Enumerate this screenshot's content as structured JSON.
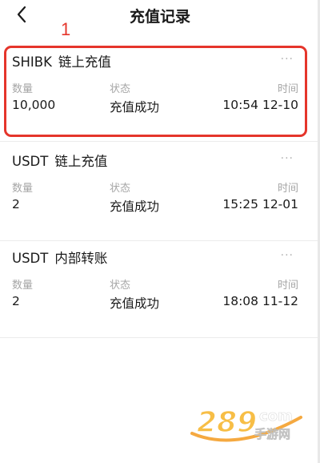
{
  "header": {
    "title": "充值记录"
  },
  "annotation": {
    "number": "1"
  },
  "labels": {
    "quantity": "数量",
    "status": "状态",
    "time": "时间",
    "more": "···"
  },
  "records": [
    {
      "symbol": "SHIBK",
      "type": "链上充值",
      "quantity": "10,000",
      "status": "充值成功",
      "time": "10:54 12-10"
    },
    {
      "symbol": "USDT",
      "type": "链上充值",
      "quantity": "2",
      "status": "充值成功",
      "time": "15:25 12-01"
    },
    {
      "symbol": "USDT",
      "type": "内部转账",
      "quantity": "2",
      "status": "充值成功",
      "time": "18:08 11-12"
    }
  ],
  "watermark": {
    "text": "289",
    "suffix": "com",
    "subtitle": "手游网"
  },
  "colors": {
    "accent_red": "#e5352b",
    "label_gray": "#a6a6a6",
    "text_dark": "#1a1a1a"
  }
}
